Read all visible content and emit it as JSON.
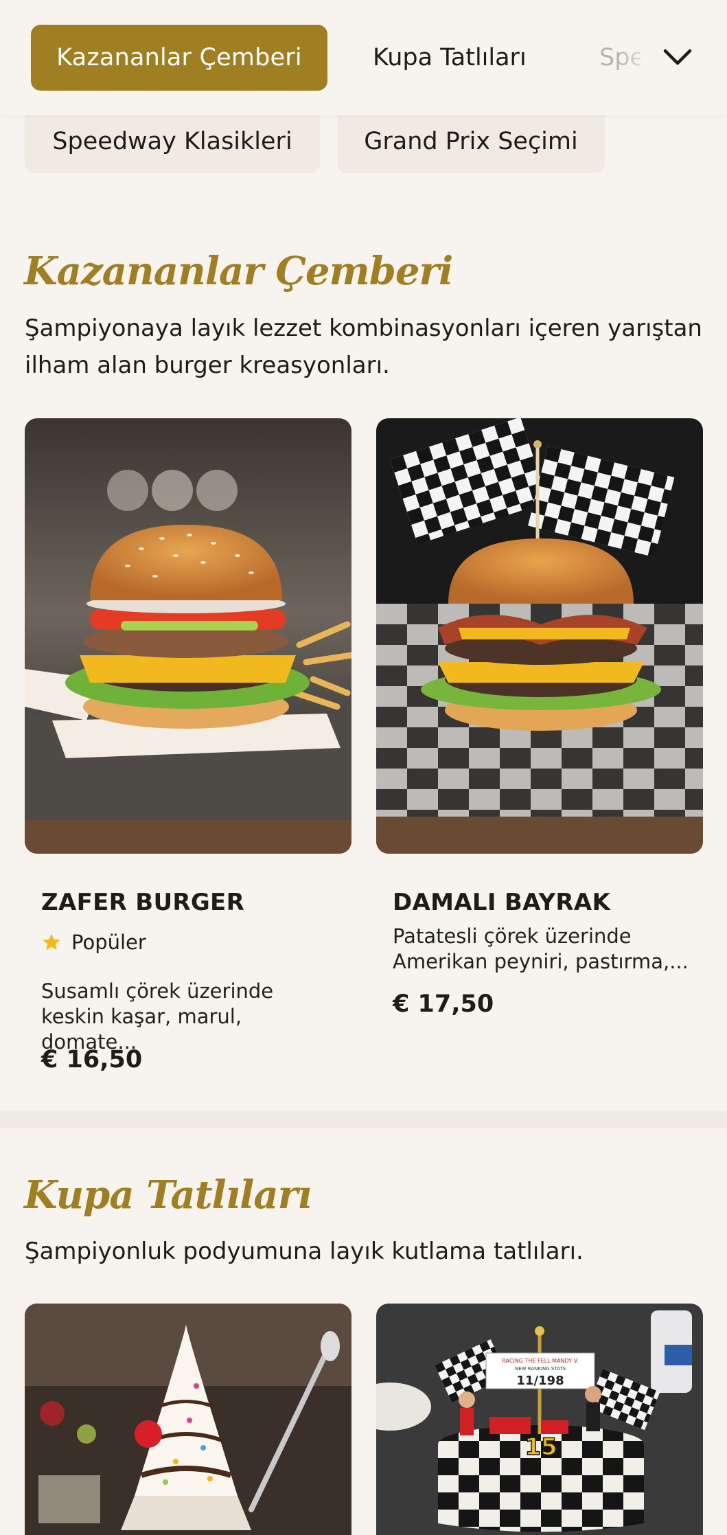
{
  "nav": {
    "tabs": [
      {
        "label": "Kazananlar Çemberi",
        "active": true
      },
      {
        "label": "Kupa Tatlıları",
        "active": false
      },
      {
        "label": "Speedway Klasikleri",
        "active": false
      }
    ],
    "chevron_icon": "chevron-down-icon"
  },
  "subnav": {
    "tabs": [
      {
        "label": "Speedway Klasikleri"
      },
      {
        "label": "Grand Prix Seçimi"
      }
    ]
  },
  "sections": [
    {
      "title": "Kazananlar Çemberi",
      "description": "Şampiyonaya layık lezzet kombinasyonları içeren yarıştan ilham alan burger kreasyonları.",
      "items": [
        {
          "name": "ZAFER BURGER",
          "badge": "Popüler",
          "badge_icon": "star-icon",
          "description_line1": "Susamlı çörek üzerinde",
          "description_line2": "keskin kaşar, marul, domate...",
          "price": "€ 16,50"
        },
        {
          "name": "DAMALI BAYRAK",
          "description_line1": "Patatesli çörek üzerinde",
          "description_line2": "Amerikan peyniri, pastırma,...",
          "price": "€ 17,50"
        }
      ]
    },
    {
      "title": "Kupa Tatlıları",
      "description": "Şampiyonluk podyumuna layık kutlama tatlıları."
    }
  ],
  "images": {
    "cake_sign_line1": "RACING THE FELL MANDY V.",
    "cake_sign_line2": "NEW RANKING STATS",
    "cake_sign_number": "11/198",
    "cake_number": "15"
  },
  "colors": {
    "accent": "#a07f23",
    "background": "#f7f3ee",
    "star": "#f2b81b"
  }
}
